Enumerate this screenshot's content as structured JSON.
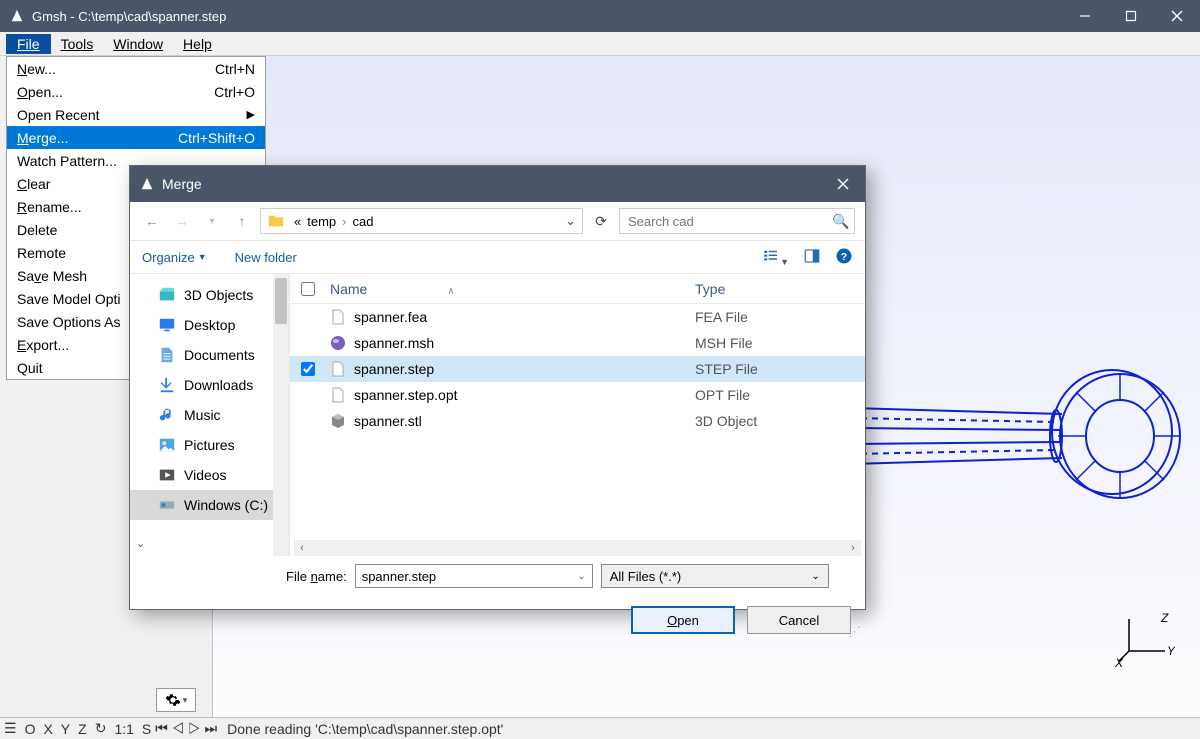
{
  "window": {
    "title": "Gmsh - C:\\temp\\cad\\spanner.step"
  },
  "menubar": {
    "file": "File",
    "tools": "Tools",
    "window": "Window",
    "help": "Help"
  },
  "file_menu": {
    "new": "New...",
    "new_sc": "Ctrl+N",
    "open": "Open...",
    "open_sc": "Ctrl+O",
    "open_recent": "Open Recent",
    "merge": "Merge...",
    "merge_sc": "Ctrl+Shift+O",
    "watch": "Watch Pattern...",
    "clear": "Clear",
    "rename": "Rename...",
    "delete": "Delete",
    "remote": "Remote",
    "save_mesh": "Save Mesh",
    "save_model": "Save Model Options",
    "save_options": "Save Options As Default",
    "export": "Export...",
    "quit": "Quit"
  },
  "dialog": {
    "title": "Merge",
    "breadcrumb": {
      "sep1": "«",
      "p1": "temp",
      "sep2": "›",
      "p2": "cad"
    },
    "search_placeholder": "Search cad",
    "organize": "Organize",
    "new_folder": "New folder",
    "col_name": "Name",
    "col_type": "Type",
    "tree": {
      "obj3d": "3D Objects",
      "desktop": "Desktop",
      "documents": "Documents",
      "downloads": "Downloads",
      "music": "Music",
      "pictures": "Pictures",
      "videos": "Videos",
      "c_drive": "Windows (C:)"
    },
    "files": [
      {
        "name": "spanner.fea",
        "type": "FEA File",
        "checked": false,
        "selected": false,
        "icon": "file"
      },
      {
        "name": "spanner.msh",
        "type": "MSH File",
        "checked": false,
        "selected": false,
        "icon": "ball"
      },
      {
        "name": "spanner.step",
        "type": "STEP File",
        "checked": true,
        "selected": true,
        "icon": "file"
      },
      {
        "name": "spanner.step.opt",
        "type": "OPT File",
        "checked": false,
        "selected": false,
        "icon": "file"
      },
      {
        "name": "spanner.stl",
        "type": "3D Object",
        "checked": false,
        "selected": false,
        "icon": "cube"
      }
    ],
    "filename_label": "File name:",
    "filename_value": "spanner.step",
    "filter": "All Files (*.*)",
    "open_btn": "Open",
    "cancel_btn": "Cancel"
  },
  "statusbar": {
    "btn_o": "O",
    "btn_x": "X",
    "btn_y": "Y",
    "btn_z": "Z",
    "scale": "1:1",
    "btn_s": "S",
    "message": "Done reading 'C:\\temp\\cad\\spanner.step.opt'"
  },
  "axis": {
    "x": "X",
    "y": "Y",
    "z": "Z"
  }
}
